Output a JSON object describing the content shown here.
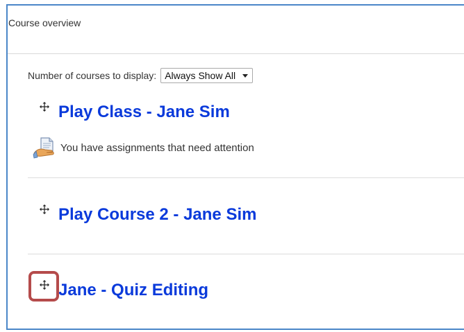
{
  "block": {
    "title": "Course overview"
  },
  "display": {
    "label": "Number of courses to display:",
    "selected": "Always Show All"
  },
  "courses": [
    {
      "title": "Play Class - Jane Sim",
      "alert": "You have assignments that need attention"
    },
    {
      "title": "Play Course 2 - Jane Sim"
    },
    {
      "title": "Jane - Quiz Editing"
    }
  ],
  "colors": {
    "link": "#0a3adb",
    "frame_border": "#4a86c8",
    "highlight": "#b54b4b"
  },
  "icons": {
    "move": "move-arrows-icon",
    "assignment": "assignment-hand-icon"
  }
}
